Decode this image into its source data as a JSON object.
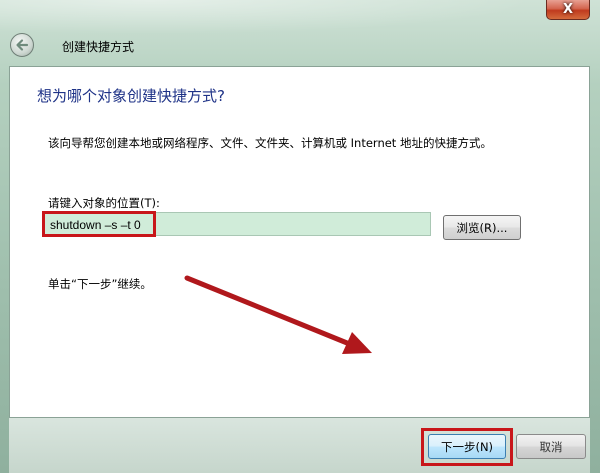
{
  "window": {
    "title": "创建快捷方式",
    "close_glyph": "X"
  },
  "page": {
    "heading": "想为哪个对象创建快捷方式?",
    "description": "该向导帮您创建本地或网络程序、文件、文件夹、计算机或 Internet 地址的快捷方式。",
    "location_label": "请键入对象的位置(T):",
    "location_value": "shutdown –s –t 0",
    "browse_label": "浏览(R)...",
    "hint": "单击“下一步”继续。"
  },
  "buttons": {
    "next_label": "下一步(N)",
    "cancel_label": "取消"
  },
  "colors": {
    "annotation": "#c8161a",
    "heading": "#1e3287",
    "input_bg": "#d0ecd9"
  },
  "icons": {
    "back": "back-arrow-icon",
    "close": "close-icon"
  }
}
